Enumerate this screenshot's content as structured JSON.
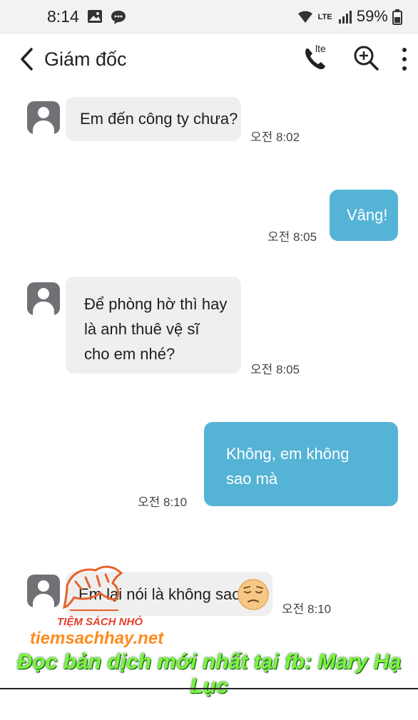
{
  "status_bar": {
    "time": "8:14",
    "network": "LTE",
    "battery": "59%",
    "icons": [
      "gallery-icon",
      "sms-icon",
      "wifi-icon",
      "signal-icon",
      "battery-icon"
    ]
  },
  "header": {
    "title": "Giám đốc",
    "call_badge": "lte",
    "icons": [
      "back-icon",
      "call-icon",
      "search-icon",
      "more-icon"
    ]
  },
  "messages": [
    {
      "side": "in",
      "text": "Em đến công ty chưa?",
      "time": "오전 8:02"
    },
    {
      "side": "out",
      "text": "Vâng!",
      "time": "오전 8:05"
    },
    {
      "side": "in",
      "lines": [
        "Để phòng hờ thì hay",
        "là anh thuê vệ sĩ",
        "cho em nhé?"
      ],
      "time": "오전 8:05"
    },
    {
      "side": "out",
      "lines": [
        "Không, em không",
        "sao mà"
      ],
      "time": "오전 8:10"
    },
    {
      "side": "in",
      "text": "Em lại nói là không sao",
      "emoji": "pensive-face",
      "time": "오전 8:10"
    }
  ],
  "watermark": {
    "brand": "TIỆM SÁCH NHỎ",
    "url": "tiemsachhay.net",
    "banner": "Đọc bản dịch mới nhất tại fb: Mary Hạ Lục"
  },
  "colors": {
    "incoming_bubble": "#efefef",
    "outgoing_bubble": "#55b3d6",
    "status_bar_bg": "#f2f2f2",
    "banner_text": "#7cf53d"
  }
}
